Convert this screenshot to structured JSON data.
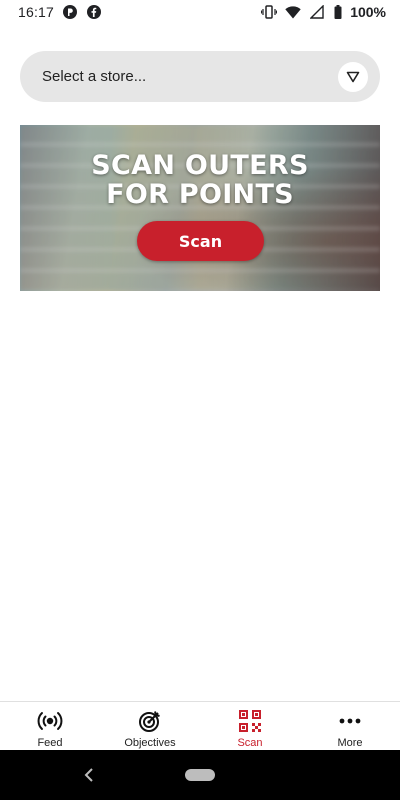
{
  "status_bar": {
    "time": "16:17",
    "battery": "100%",
    "icons_left": [
      "p-app-icon",
      "facebook-icon"
    ],
    "icons_right": [
      "vibrate-icon",
      "wifi-icon",
      "signal-icon",
      "battery-icon"
    ]
  },
  "store_selector": {
    "placeholder": "Select a store...",
    "icon": "dropdown-triangle-icon"
  },
  "banner": {
    "title_line1": "SCAN OUTERS",
    "title_line2": "FOR POINTS",
    "button_label": "Scan"
  },
  "bottom_nav": {
    "active": "Scan",
    "accent_color": "#c8202c",
    "items": [
      {
        "label": "Feed",
        "icon": "broadcast-icon"
      },
      {
        "label": "Objectives",
        "icon": "target-icon"
      },
      {
        "label": "Scan",
        "icon": "qr-code-icon"
      },
      {
        "label": "More",
        "icon": "more-dots-icon"
      }
    ]
  },
  "system_nav": {
    "icons": [
      "back-icon",
      "home-pill-icon"
    ]
  }
}
